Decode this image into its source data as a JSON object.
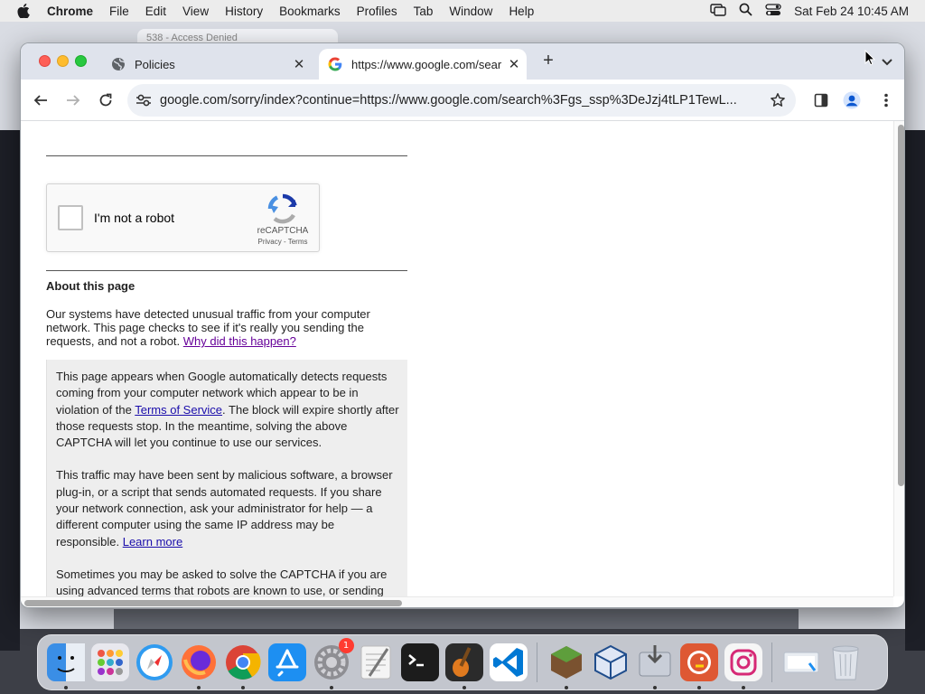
{
  "menubar": {
    "app_name": "Chrome",
    "items": [
      "File",
      "Edit",
      "View",
      "History",
      "Bookmarks",
      "Profiles",
      "Tab",
      "Window",
      "Help"
    ],
    "clock": "Sat Feb 24  10:45 AM"
  },
  "background_window": {
    "tab_title": "538 - Access Denied"
  },
  "tabs": [
    {
      "title": "Policies",
      "icon": "globe-icon",
      "close": "✕"
    },
    {
      "title": "https://www.google.com/sear",
      "icon": "google-icon",
      "close": "✕"
    }
  ],
  "new_tab_label": "+",
  "toolbar": {
    "url": "google.com/sorry/index?continue=https://www.google.com/search%3Fgs_ssp%3DeJzj4tLP1TewL..."
  },
  "captcha": {
    "label": "I'm not a robot",
    "brand": "reCAPTCHA",
    "privacy": "Privacy",
    "separator": " - ",
    "terms": "Terms"
  },
  "about": {
    "title": "About this page",
    "text": "Our systems have detected unusual traffic from your computer network. This page checks to see if it's really you sending the requests, and not a robot.",
    "why_link": "Why did this happen?"
  },
  "info": {
    "p1_before": "This page appears when Google automatically detects requests coming from your computer network which appear to be in violation of the ",
    "p1_link": "Terms of Service",
    "p1_after": ". The block will expire shortly after those requests stop. In the meantime, solving the above CAPTCHA will let you continue to use our services.",
    "p2_before": "This traffic may have been sent by malicious software, a browser plug-in, or a script that sends automated requests. If you share your network connection, ask your administrator for help — a different computer using the same IP address may be responsible. ",
    "p2_link": "Learn more",
    "p3": "Sometimes you may be asked to solve the CAPTCHA if you are using advanced terms that robots are known to use, or sending requests very quickly."
  },
  "dock": {
    "apps": [
      {
        "name": "finder-icon",
        "color": "#3a8ee6",
        "running": true
      },
      {
        "name": "launchpad-icon",
        "color": "#e8e8ee",
        "running": false
      },
      {
        "name": "safari-icon",
        "color": "#2f9bf0",
        "running": false
      },
      {
        "name": "firefox-icon",
        "color": "#6a2bd9",
        "running": true
      },
      {
        "name": "chrome-icon",
        "color": "#ffffff",
        "running": true
      },
      {
        "name": "app-store-icon",
        "color": "#1d8ff2",
        "running": false
      },
      {
        "name": "system-settings-icon",
        "color": "#8e8e93",
        "running": true,
        "badge": "1"
      },
      {
        "name": "textedit-icon",
        "color": "#f4f4f4",
        "running": false
      },
      {
        "name": "terminal-icon",
        "color": "#1c1c1c",
        "running": false
      },
      {
        "name": "garageband-icon",
        "color": "#e07a1f",
        "running": true
      },
      {
        "name": "vscode-icon",
        "color": "#ffffff",
        "running": false
      },
      {
        "name": "minecraft-icon",
        "color": "#5e9e3c",
        "running": true
      },
      {
        "name": "virtualbox-icon",
        "color": "#dfe7f5",
        "running": false
      },
      {
        "name": "installer-icon",
        "color": "#c9ced8",
        "running": true
      },
      {
        "name": "duckduckgo-icon",
        "color": "#de5833",
        "running": true
      },
      {
        "name": "instagram-icon",
        "color": "#f6f6f6",
        "running": true
      }
    ],
    "extras": [
      {
        "name": "downloads-folder-icon",
        "color": "#e9edf2"
      },
      {
        "name": "trash-icon",
        "color": "#dfe3ea"
      }
    ]
  }
}
